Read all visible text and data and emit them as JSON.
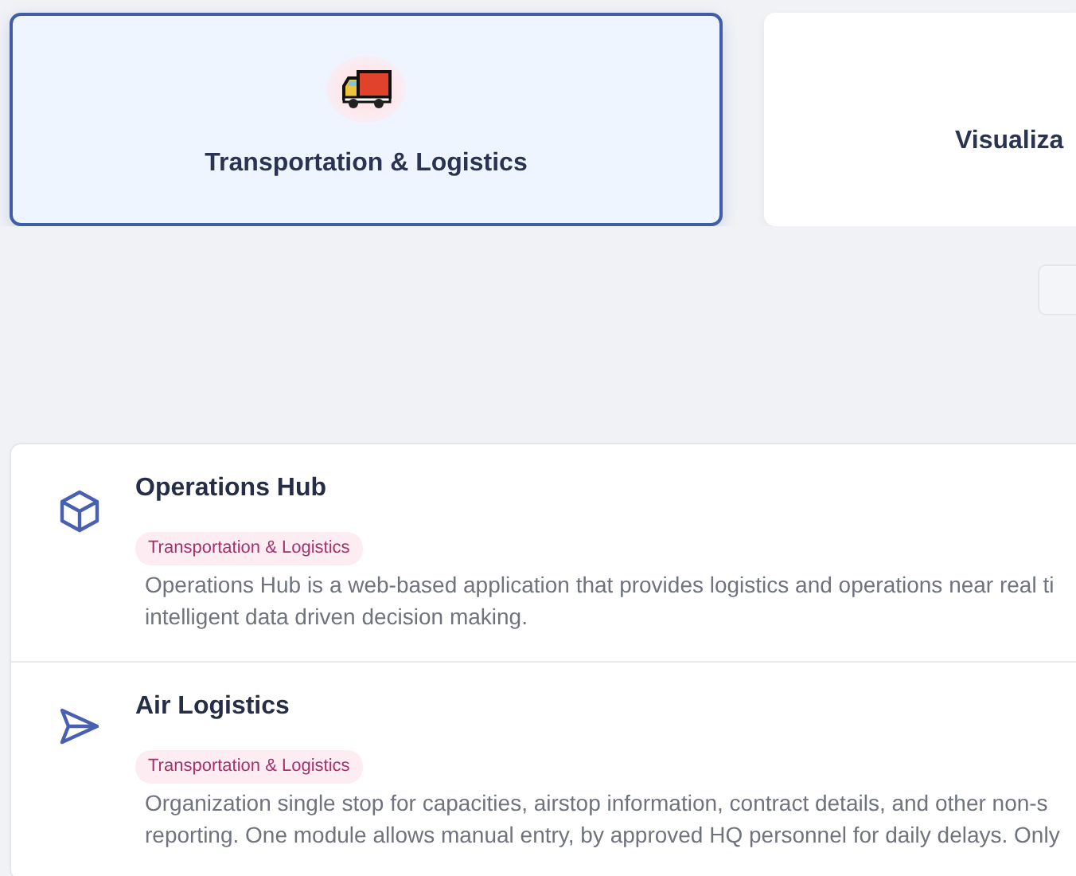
{
  "categories": [
    {
      "label": "Transportation & Logistics",
      "selected": true
    },
    {
      "label": "Visualiza",
      "selected": false
    }
  ],
  "apps": [
    {
      "title": "Operations Hub",
      "tag": "Transportation & Logistics",
      "description": "Operations Hub is a web-based application that provides logistics and operations near real ti\nintelligent data driven decision making."
    },
    {
      "title": "Air Logistics",
      "tag": "Transportation & Logistics",
      "description": "Organization single stop for capacities, airstop information, contract details, and other non-s\nreporting. One module allows manual entry, by approved HQ personnel for daily delays. Only"
    }
  ]
}
